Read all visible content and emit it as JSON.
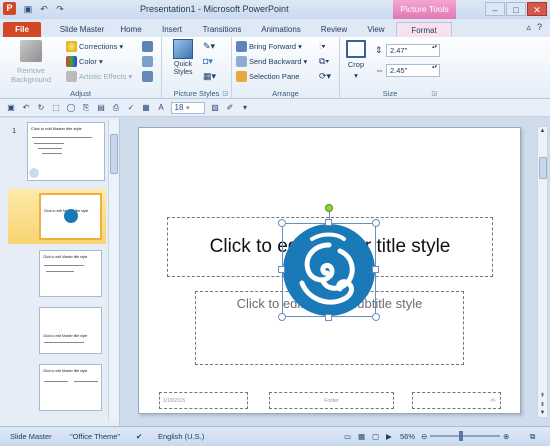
{
  "window": {
    "title": "Presentation1 - Microsoft PowerPoint",
    "app_icon": "P",
    "context_tab_header": "Picture Tools",
    "quick_access_icons": [
      "save-icon",
      "undo-icon",
      "redo-icon"
    ]
  },
  "tabs": [
    {
      "label": "File"
    },
    {
      "label": "Slide Master"
    },
    {
      "label": "Home"
    },
    {
      "label": "Insert"
    },
    {
      "label": "Transitions"
    },
    {
      "label": "Animations"
    },
    {
      "label": "Review"
    },
    {
      "label": "View"
    },
    {
      "label": "Format"
    }
  ],
  "ribbon": {
    "adjust": {
      "label": "Adjust",
      "remove_background": "Remove Background",
      "corrections": "Corrections",
      "color": "Color",
      "artistic_effects": "Artistic Effects"
    },
    "picture_styles": {
      "label": "Picture Styles",
      "quick_styles": "Quick Styles"
    },
    "arrange": {
      "label": "Arrange",
      "bring_forward": "Bring Forward",
      "send_backward": "Send Backward",
      "selection_pane": "Selection Pane"
    },
    "size": {
      "label": "Size",
      "crop": "Crop",
      "height": "2.47\"",
      "width": "2.45\""
    }
  },
  "qat": {
    "font_size": "18"
  },
  "thumbnails": [
    {
      "number": "1",
      "title": "Click to edit Master title style"
    },
    {
      "number": "",
      "title": "Click to edit Master title style"
    },
    {
      "number": "",
      "title": "Click to edit Master title style"
    },
    {
      "number": "",
      "title": "Click to edit Master title style"
    },
    {
      "number": "",
      "title": "Click to edit Master title style"
    }
  ],
  "slide": {
    "title": "Click to edit Master title style",
    "subtitle": "Click to edit Master subtitle style",
    "date": "1/18/2015",
    "footer": "Footer",
    "page_number": "‹#›"
  },
  "status": {
    "view": "Slide Master",
    "theme": "\"Office Theme\"",
    "language": "English (U.S.)",
    "zoom": "56%"
  },
  "colors": {
    "accent_file": "#d24726",
    "picture_tools": "#e078b3",
    "logo_blue": "#1a7ab8"
  }
}
